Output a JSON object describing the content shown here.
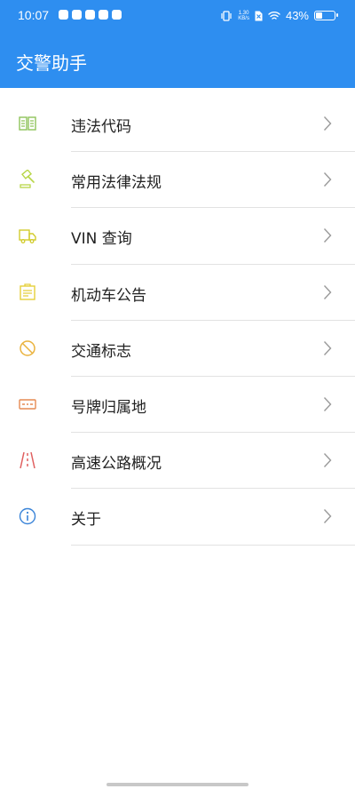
{
  "status_bar": {
    "time": "10:07",
    "net_speed_value": "1.30",
    "net_speed_unit": "KB/s",
    "battery_text": "43%",
    "battery_level": 0.43
  },
  "header": {
    "title": "交警助手"
  },
  "menu": {
    "items": [
      {
        "label": "违法代码",
        "icon": "book-icon"
      },
      {
        "label": "常用法律法规",
        "icon": "gavel-icon"
      },
      {
        "label": "VIN 查询",
        "icon": "truck-icon"
      },
      {
        "label": "机动车公告",
        "icon": "notice-icon"
      },
      {
        "label": "交通标志",
        "icon": "prohibited-sign-icon"
      },
      {
        "label": "号牌归属地",
        "icon": "license-plate-icon"
      },
      {
        "label": "高速公路概况",
        "icon": "highway-icon"
      },
      {
        "label": "关于",
        "icon": "info-icon"
      }
    ]
  },
  "colors": {
    "primary": "#2e8ef0",
    "book": "#8fc35a",
    "gavel": "#b8d648",
    "truck": "#d2cc2e",
    "notice": "#e5cf3a",
    "prohibited": "#eab23c",
    "plate": "#e68a52",
    "highway": "#e06060",
    "info": "#3a84d8"
  }
}
